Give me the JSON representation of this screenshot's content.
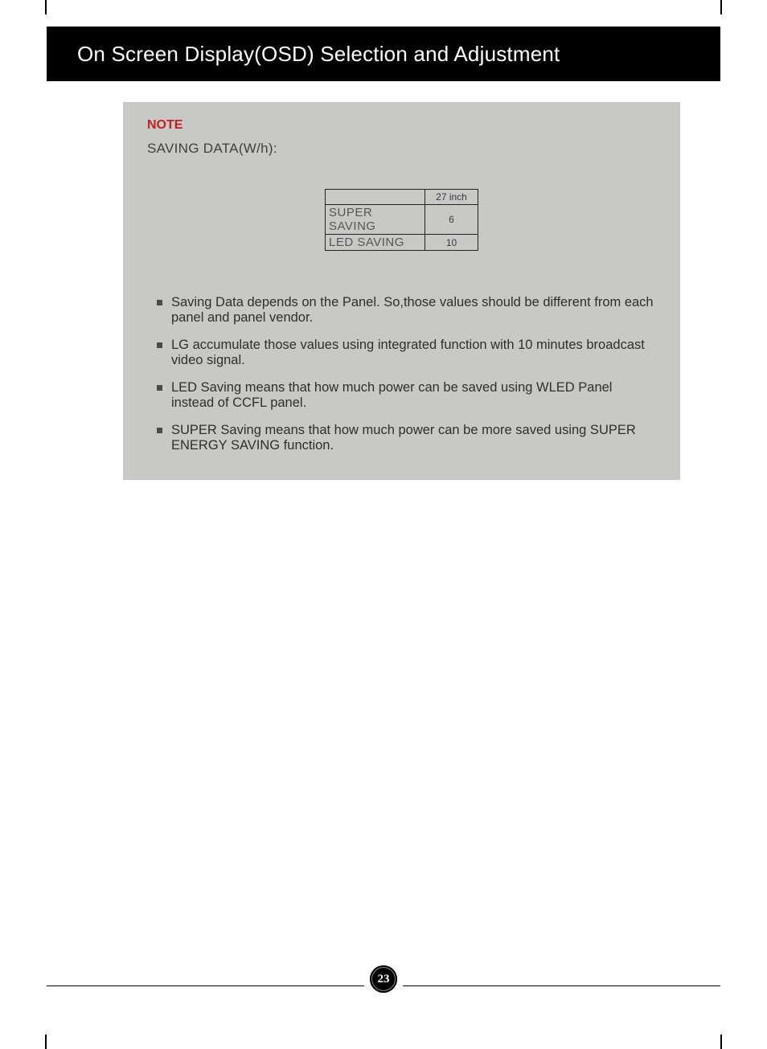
{
  "header": {
    "title": "On Screen Display(OSD) Selection and Adjustment"
  },
  "note": {
    "label": "NOTE",
    "subtitle": "SAVING DATA(W/h):",
    "table": {
      "col_header": "27 inch",
      "rows": [
        {
          "label": "SUPER SAVING",
          "value": "6"
        },
        {
          "label": "LED SAVING",
          "value": "10"
        }
      ]
    },
    "bullets": [
      "Saving Data depends on the Panel. So,those values should be different from each panel and panel vendor.",
      "LG accumulate those values using integrated function with 10 minutes broadcast video signal.",
      "LED Saving means that how much power can be saved using WLED Panel instead of CCFL panel.",
      "SUPER Saving means that how much power can be more saved using SUPER ENERGY SAVING function."
    ]
  },
  "page_number": "23"
}
